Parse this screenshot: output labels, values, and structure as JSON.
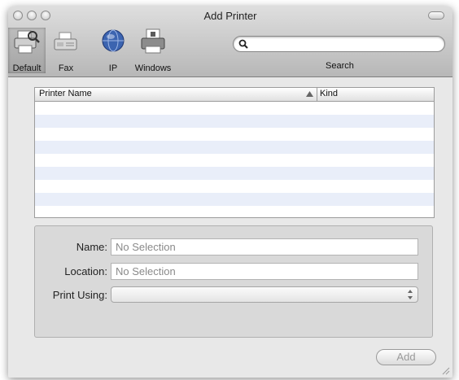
{
  "window": {
    "title": "Add Printer"
  },
  "toolbar": {
    "buttons": [
      {
        "label": "Default",
        "icon": "printer-magnifier-icon",
        "selected": true
      },
      {
        "label": "Fax",
        "icon": "fax-icon",
        "selected": false
      },
      {
        "label": "IP",
        "icon": "globe-icon",
        "selected": false
      },
      {
        "label": "Windows",
        "icon": "windows-printer-icon",
        "selected": false
      }
    ],
    "search": {
      "value": "",
      "placeholder": "",
      "label": "Search"
    }
  },
  "printer_table": {
    "columns": [
      "Printer Name",
      "Kind"
    ],
    "sort_column": "Printer Name",
    "rows": []
  },
  "details": {
    "name_label": "Name:",
    "name_value": "No Selection",
    "location_label": "Location:",
    "location_value": "No Selection",
    "print_using_label": "Print Using:",
    "print_using_value": ""
  },
  "add_button": {
    "label": "Add",
    "enabled": false
  },
  "colors": {
    "stripe": "#e9eef9",
    "title_gradient_top": "#dedede",
    "disabled_text": "#9a9a9a"
  }
}
